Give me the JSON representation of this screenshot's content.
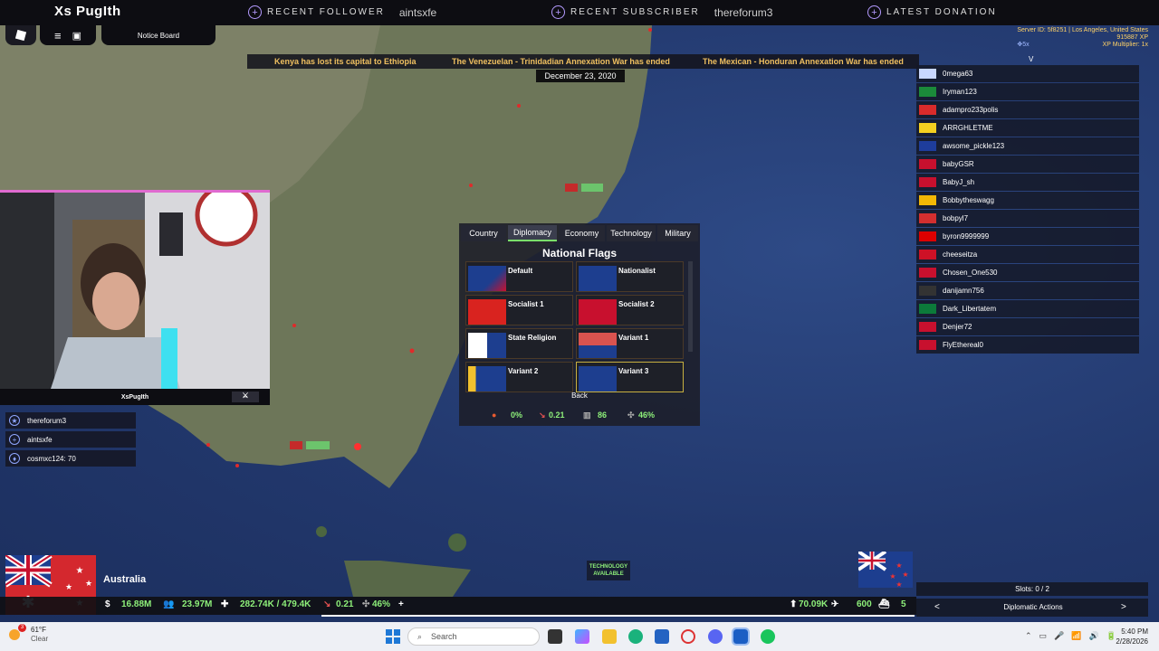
{
  "stream": {
    "brand": "Xs PugIth",
    "alerts": [
      {
        "label": "RECENT FOLLOWER",
        "value": "aintsxfe"
      },
      {
        "label": "RECENT SUBSCRIBER",
        "value": "thereforum3"
      },
      {
        "label": "LATEST DONATION",
        "value": ""
      }
    ],
    "webcam_caption": "XsPugIth",
    "events": [
      {
        "text": "thereforum3",
        "icon": "star-icon"
      },
      {
        "text": "aintsxfe",
        "icon": "plus-icon"
      },
      {
        "text": "cosmxc124: 70",
        "icon": "drop-icon"
      }
    ]
  },
  "game": {
    "notice_board": "Notice Board",
    "ticker": [
      "Kenya has lost its capital to Ethiopia",
      "The Venezuelan - Trinidadian Annexation War has ended",
      "The Mexican - Honduran Annexation War has ended"
    ],
    "date": "December 23, 2020",
    "server": {
      "id_line": "Server ID: 5f8251 | Los Angeles, United States",
      "xp": "915887 XP",
      "multiplier": "XP Multiplier: 1x",
      "zoom": "5x"
    },
    "player_list_header": "V",
    "players": [
      "0mega63",
      "Iryman123",
      "adampro233polis",
      "ARRGHLETME",
      "awsome_pickle123",
      "babyGSR",
      "BabyJ_sh",
      "Bobbytheswagg",
      "bobpyl7",
      "byron9999999",
      "cheeseitza",
      "Chosen_One530",
      "danijamn756",
      "Dark_Libertatem",
      "Denjer72",
      "FlyEthereal0"
    ],
    "panel": {
      "tabs": [
        "Country",
        "Diplomacy",
        "Economy",
        "Technology",
        "Military"
      ],
      "active_tab": "Diplomacy",
      "title": "National Flags",
      "flags": [
        "Default",
        "Nationalist",
        "Socialist 1",
        "Socialist 2",
        "State Religion",
        "Variant 1",
        "Variant 2",
        "Variant 3"
      ],
      "back": "Back",
      "stats": {
        "a": "0%",
        "b": "0.21",
        "c": "86",
        "d": "46%"
      }
    },
    "country": "Australia",
    "tech_notice": "TECHNOLOGY AVAILABLE",
    "hud": {
      "money": "16.88M",
      "population": "23.97M",
      "manpower": "282.74K / 479.4K",
      "rate": "0.21",
      "stability": "46%",
      "troops": "70.09K",
      "air": "600",
      "navy": "5"
    },
    "slots": "Slots: 0 / 2",
    "diplomatic_actions": "Diplomatic Actions",
    "nav_prev": "<",
    "nav_next": ">"
  },
  "taskbar": {
    "weather_temp": "61°F",
    "weather_desc": "Clear",
    "search": "Search",
    "time": "5:40 PM",
    "date": "2/28/2026",
    "notif_count": "3"
  }
}
